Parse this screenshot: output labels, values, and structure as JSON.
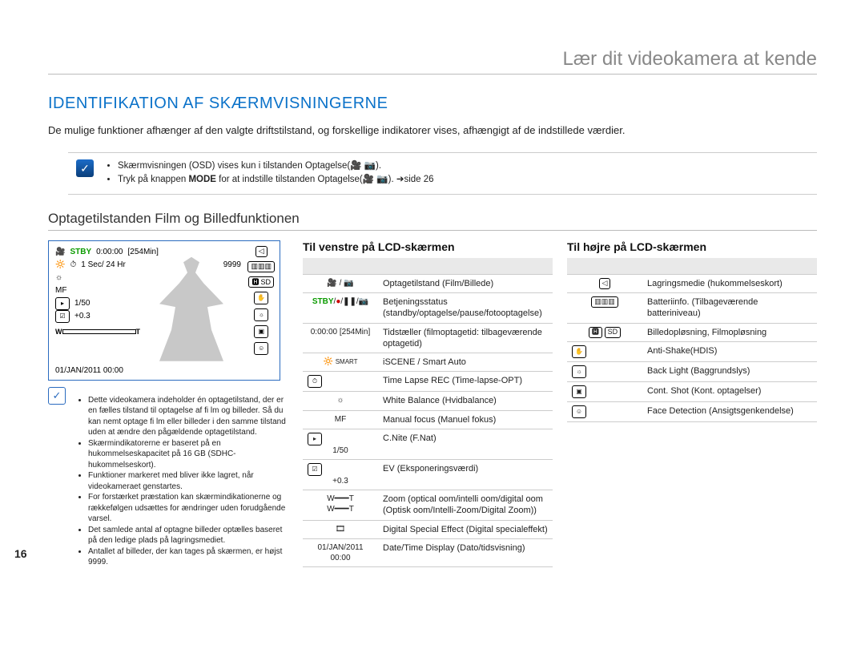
{
  "page_number": "16",
  "chapter_title": "Lær dit videokamera at kende",
  "section_title": "IDENTIFIKATION AF SKÆRMVISNINGERNE",
  "intro_text": "De mulige funktioner afhænger af den valgte driftstilstand, og forskellige indikatorer vises, afhængigt af de indstillede værdier.",
  "note_box": {
    "bullet1_a": "Skærmvisningen (OSD) vises kun i tilstanden Optagelse(",
    "bullet1_b": ").",
    "bullet2_a": "Tryk på knappen ",
    "bullet2_mode": "MODE",
    "bullet2_b": " for at indstille tilstanden Optagelse(",
    "bullet2_c": "). ",
    "bullet2_ref": "➔side 26"
  },
  "subhead": "Optagetilstanden Film og Billedfunktionen",
  "lcd": {
    "stby": "STBY",
    "time": "0:00:00",
    "remain": "[254Min]",
    "interval": "1 Sec/ 24 Hr",
    "count": "9999",
    "shutter": "1/50",
    "ev": "+0.3",
    "w": "W",
    "t": "T",
    "date": "01/JAN/2011 00:00",
    "sd_label": "SD"
  },
  "left_notes": {
    "n1": "Dette videokamera indeholder én optagetilstand, der er en fælles tilstand til optagelse af fi lm og billeder. Så du kan nemt optage fi lm eller billeder i den samme tilstand uden at ændre den pågældende optagetilstand.",
    "n2": "Skærmindikatorerne er baseret på en hukommelseskapacitet på 16 GB (SDHC-hukommelseskort).",
    "n3": "Funktioner markeret med  bliver ikke lagret, når videokameraet genstartes.",
    "n4": "For forstærket præstation kan skærmindikationerne og rækkefølgen udsættes for ændringer uden forudgående varsel.",
    "n5": "Det samlede antal af optagne billeder optælles baseret på den ledige plads på lagringsmediet.",
    "n6": "Antallet af billeder, der kan tages på skærmen, er højst 9999."
  },
  "left_table": {
    "title": "Til venstre på LCD-skærmen",
    "rows": [
      {
        "icon": "🎥 / 📷",
        "desc": "Optagetilstand (Film/Billede)"
      },
      {
        "icon": "STBY/●/❚❚/📷",
        "desc": "Betjeningsstatus (standby/optagelse/pause/fotooptagelse)"
      },
      {
        "icon": "0:00:00 [254Min]",
        "desc": "Tidstæller (filmoptagetid: tilbageværende optagetid)"
      },
      {
        "icon": "🔆 SMART",
        "desc": "iSCENE  / Smart Auto"
      },
      {
        "icon": "⏱",
        "desc": "Time Lapse REC (Time-lapse-OPT)"
      },
      {
        "icon": "☼",
        "desc": "White Balance (Hvidbalance)"
      },
      {
        "icon": "MF",
        "desc": "Manual focus (Manuel fokus)"
      },
      {
        "icon": "▸ 1/50",
        "desc": "C.Nite (F.Nat)"
      },
      {
        "icon": "☑ +0.3",
        "desc": "EV (Eksponeringsværdi)"
      },
      {
        "icon": "W━━━T",
        "desc": "Zoom (optical oom/intelli oom/digital oom (Optisk oom/Intelli-Zoom/Digital Zoom))"
      },
      {
        "icon": "🎞",
        "desc": "Digital Special Effect (Digital specialeffekt)"
      },
      {
        "icon": "01/JAN/2011 00:00",
        "desc": "Date/Time Display (Dato/tidsvisning)"
      }
    ]
  },
  "right_table": {
    "title": "Til højre på LCD-skærmen",
    "rows": [
      {
        "icon": "◁",
        "desc": "Lagringsmedie (hukommelseskort)"
      },
      {
        "icon": "▥▥▥",
        "desc": "Batteriinfo. (Tilbageværende batteriniveau)"
      },
      {
        "icon": "🅷 SD",
        "desc": "Billedopløsning, Filmopløsning"
      },
      {
        "icon": "✋",
        "desc": "Anti-Shake(HDIS)"
      },
      {
        "icon": "☼↺",
        "desc": "Back Light (Baggrundslys)"
      },
      {
        "icon": "▣",
        "desc": "Cont. Shot (Kont. optagelser)"
      },
      {
        "icon": "☺",
        "desc": "Face Detection (Ansigtsgenkendelse)"
      }
    ]
  }
}
